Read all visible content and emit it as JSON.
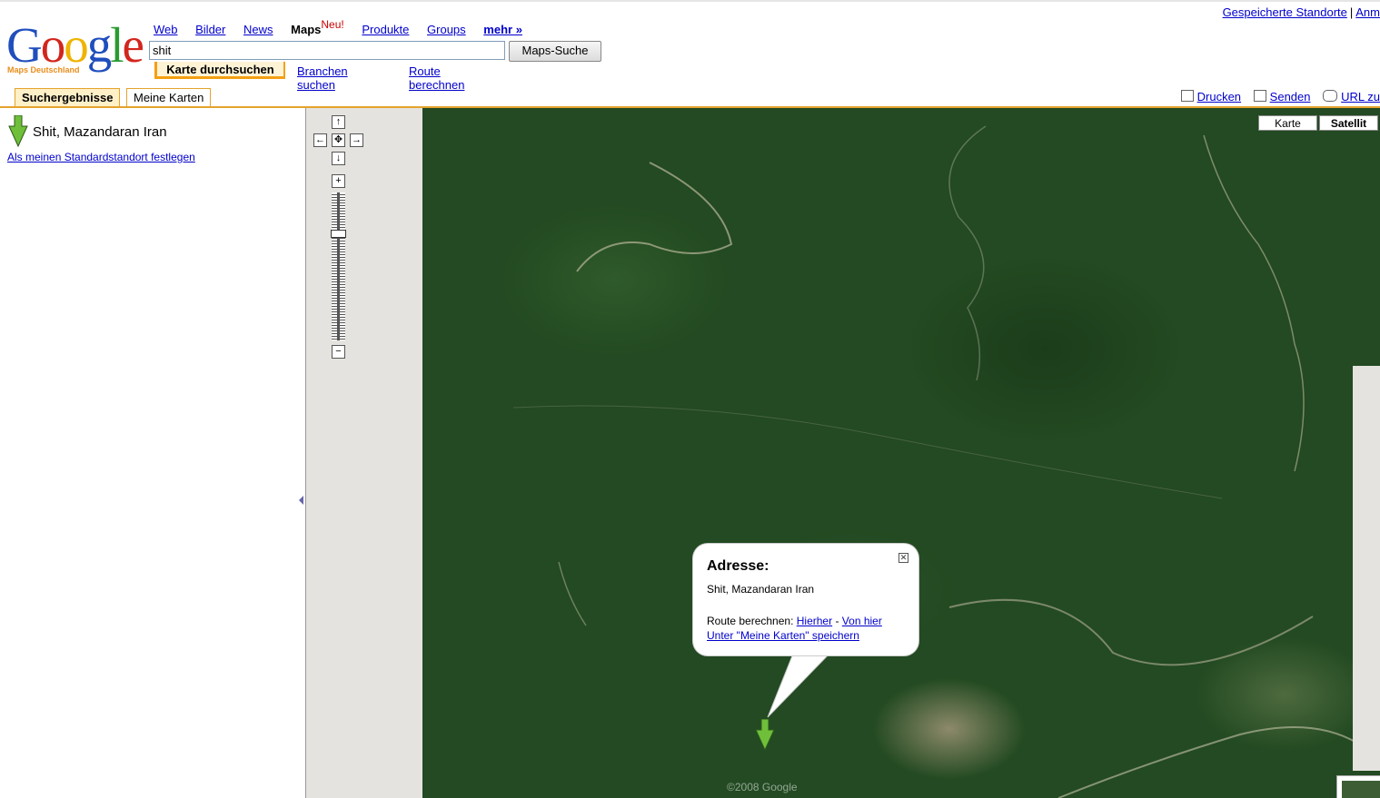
{
  "top_links": {
    "saved_places": "Gespeicherte Standorte",
    "sep": "|",
    "signin": "Anm"
  },
  "logo": {
    "word": "Google",
    "sub": "Maps Deutschland"
  },
  "nav": {
    "web": "Web",
    "images": "Bilder",
    "news": "News",
    "maps": "Maps",
    "new_badge": "Neu!",
    "products": "Produkte",
    "groups": "Groups",
    "more": "mehr »"
  },
  "search": {
    "value": "shit",
    "button": "Maps-Suche"
  },
  "subtabs": {
    "browse": "Karte durchsuchen",
    "business": "Branchen suchen",
    "route": "Route berechnen"
  },
  "result_tabs": {
    "results": "Suchergebnisse",
    "my_maps": "Meine Karten"
  },
  "actions": {
    "print": "Drucken",
    "send": "Senden",
    "url": "URL zu"
  },
  "results": [
    {
      "title": "Shit, Mazandaran Iran"
    }
  ],
  "set_default": "Als meinen Standardstandort festlegen",
  "map_types": {
    "map": "Karte",
    "satellite": "Satellit"
  },
  "infowindow": {
    "title": "Adresse:",
    "address": "Shit, Mazandaran Iran",
    "route_label": "Route berechnen:",
    "to_here": "Hierher",
    "dash": "-",
    "from_here": "Von hier",
    "save": "Unter \"Meine Karten\" speichern"
  },
  "colors": {
    "accent_orange": "#e5a32d",
    "link": "#0000cc",
    "marker_green": "#6fbf3a"
  },
  "copyright": "©2008 Google"
}
